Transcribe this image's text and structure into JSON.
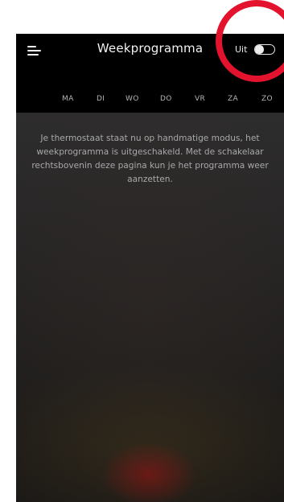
{
  "header": {
    "title": "Weekprogramma",
    "toggle_label": "Uit",
    "menu_icon": "hamburger-menu-icon"
  },
  "toggle": {
    "state": "off"
  },
  "days": [
    "MA",
    "DI",
    "WO",
    "DO",
    "VR",
    "ZA",
    "ZO"
  ],
  "message": "Je thermostaat staat nu op handmatige modus, het weekprogramma is uitgeschakeld. Met de schakelaar rechtsbovenin deze pagina kun je het programma weer aanzetten.",
  "colors": {
    "header_bg": "#000000",
    "annotation_circle": "#e3122d",
    "text_muted": "#a9a9a9"
  }
}
